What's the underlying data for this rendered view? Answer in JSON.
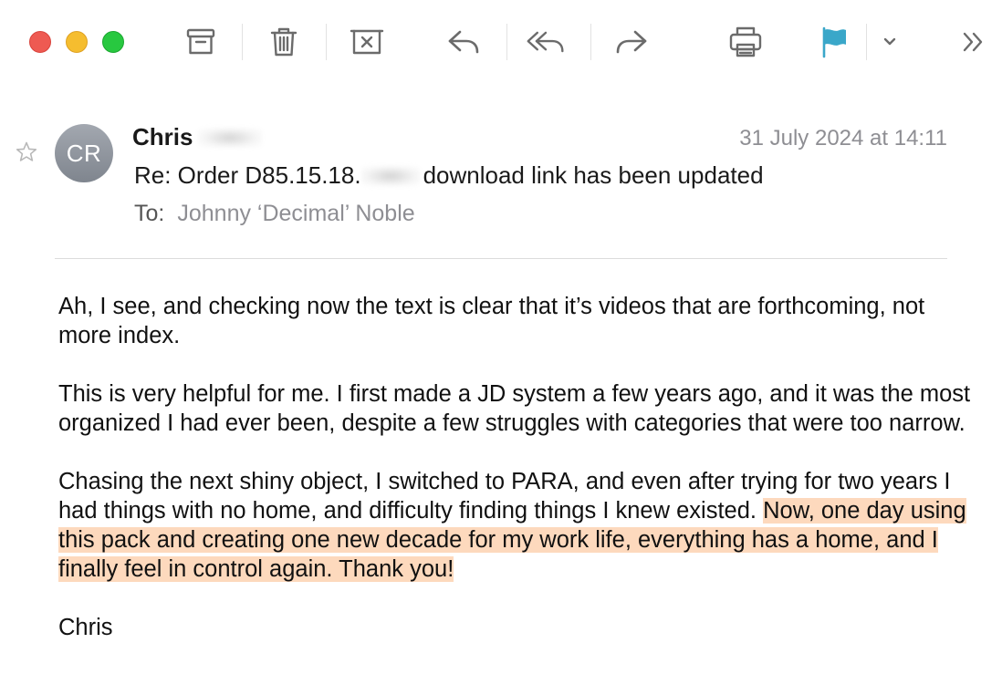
{
  "window": {
    "traffic_lights": [
      "close",
      "minimize",
      "zoom"
    ]
  },
  "toolbar": {
    "icons": [
      "archive-icon",
      "trash-icon",
      "junk-icon",
      "reply-icon",
      "reply-all-icon",
      "forward-icon",
      "print-icon",
      "flag-icon",
      "chevron-down-icon",
      "more-icon"
    ],
    "flag_color": "#3aa7c9"
  },
  "message": {
    "sender_first_name": "Chris",
    "avatar_initials": "CR",
    "date": "31 July 2024 at 14:11",
    "subject_prefix": "Re: Order D85.15.18.",
    "subject_suffix": "download link has been updated",
    "to_label": "To:",
    "to_value": "Johnny ‘Decimal’ Noble"
  },
  "body": {
    "p1": "Ah, I see, and checking now the text is clear that it’s videos that are forthcoming, not more index.",
    "p2": "This is very helpful for me. I first made a JD system a few years ago, and it was the most organized I had ever been, despite a few struggles with categories that were too narrow.",
    "p3_plain": "Chasing the next shiny object, I switched to PARA, and even after trying for two years I had things with no home, and difficulty finding things I knew existed.",
    "p3_highlight": "Now, one day using this pack and creating one new decade for my work life, everything has a home, and I finally feel in control again. Thank you!",
    "signature": "Chris",
    "highlight_color": "#fdd9bd"
  }
}
